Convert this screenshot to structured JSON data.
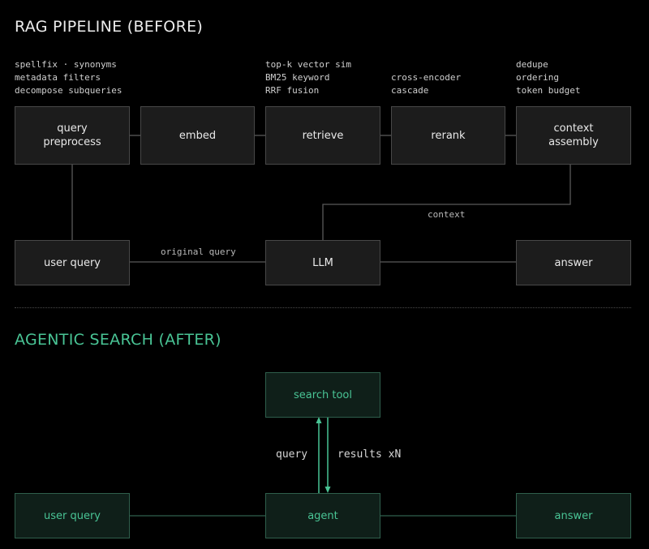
{
  "before": {
    "title": "RAG PIPELINE (BEFORE)",
    "annotations": {
      "preprocess": [
        "spellfix · synonyms",
        "metadata filters",
        "decompose subqueries"
      ],
      "retrieve": [
        "top-k vector sim",
        "BM25 keyword",
        "RRF fusion"
      ],
      "rerank": [
        "cross-encoder",
        "cascade"
      ],
      "assembly": [
        "dedupe",
        "ordering",
        "token budget"
      ]
    },
    "nodes": {
      "query_preprocess": "query\npreprocess",
      "embed": "embed",
      "retrieve": "retrieve",
      "rerank": "rerank",
      "context_assembly": "context\nassembly",
      "user_query": "user query",
      "llm": "LLM",
      "answer": "answer"
    },
    "edge_labels": {
      "context": "context",
      "original_query": "original query"
    }
  },
  "after": {
    "title": "AGENTIC SEARCH (AFTER)",
    "nodes": {
      "search_tool": "search tool",
      "user_query": "user query",
      "agent": "agent",
      "answer": "answer"
    },
    "edge_labels": {
      "query": "query",
      "results": "results xN"
    }
  },
  "colors": {
    "background": "#000000",
    "node_fill": "#1c1c1c",
    "node_border": "#484848",
    "accent_green": "#49c495",
    "green_fill": "#0f1f19",
    "green_border": "#2f5f4c",
    "line_grey": "#5a5a5a"
  }
}
